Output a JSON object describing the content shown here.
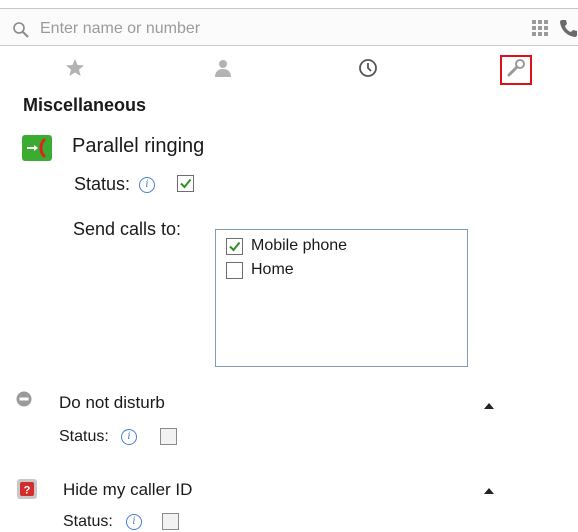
{
  "search": {
    "placeholder": "Enter name or number"
  },
  "tabs": [
    {
      "name": "favorites",
      "icon": "star-icon"
    },
    {
      "name": "contacts",
      "icon": "person-icon"
    },
    {
      "name": "history",
      "icon": "clock-icon"
    },
    {
      "name": "tools",
      "icon": "wrench-icon",
      "selected": true
    }
  ],
  "section": {
    "title": "Miscellaneous"
  },
  "parallel_ringing": {
    "title": "Parallel ringing",
    "status_label": "Status:",
    "status_checked": true,
    "send_calls_label": "Send calls to:",
    "targets": [
      {
        "label": "Mobile phone",
        "checked": true
      },
      {
        "label": "Home",
        "checked": false
      }
    ]
  },
  "do_not_disturb": {
    "title": "Do not disturb",
    "status_label": "Status:",
    "status_checked": false
  },
  "hide_caller_id": {
    "title": "Hide my caller ID",
    "status_label": "Status:",
    "status_checked": false
  },
  "colors": {
    "accent_green": "#3cab32",
    "highlight_red": "#e0101a",
    "info_blue": "#4a7fd0"
  }
}
